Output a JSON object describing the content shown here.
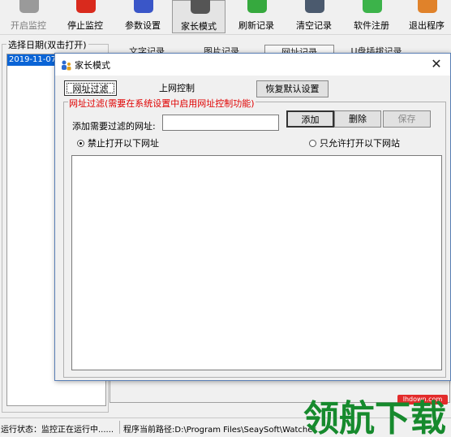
{
  "colors": {
    "selection": "#0a64d6",
    "warning_text": "#e00000",
    "window_bg": "#f0f0f0",
    "watermark_red": "#e32b2b",
    "watermark_green": "#168a2d"
  },
  "toolbar": {
    "items": [
      {
        "label": "开启监控",
        "icon": "start-icon",
        "state": "disabled"
      },
      {
        "label": "停止监控",
        "icon": "stop-icon",
        "state": "normal"
      },
      {
        "label": "参数设置",
        "icon": "settings-icon",
        "state": "normal"
      },
      {
        "label": "家长模式",
        "icon": "parent-mode-icon",
        "state": "pressed"
      },
      {
        "label": "刷新记录",
        "icon": "refresh-icon",
        "state": "normal"
      },
      {
        "label": "清空记录",
        "icon": "clear-icon",
        "state": "normal"
      },
      {
        "label": "软件注册",
        "icon": "register-icon",
        "state": "normal"
      },
      {
        "label": "退出程序",
        "icon": "exit-icon",
        "state": "normal"
      }
    ]
  },
  "date_panel": {
    "title": "选择日期(双击打开)",
    "selected_date": "2019-11-07"
  },
  "record_tabs": [
    "文字记录",
    "图片记录",
    "网址记录",
    "U盘插拔记录"
  ],
  "status_bar": {
    "status": "运行状态：监控正在运行中......",
    "path": "程序当前路径:D:\\Program Files\\SeaySoft\\Watcher"
  },
  "dialog": {
    "title": "家长模式",
    "close_glyph": "✕",
    "tabs": [
      "网址过滤",
      "上网控制"
    ],
    "restore_button": "恢复默认设置",
    "filter_group_title": "网址过滤(需要在系统设置中启用网址控制功能)",
    "url_label": "添加需要过滤的网址:",
    "url_value": "",
    "buttons": {
      "add": "添加",
      "delete": "删除",
      "save": "保存"
    },
    "radio_block": "禁止打开以下网址",
    "radio_allow": "只允许打开以下网站",
    "radio_selected": "block"
  },
  "watermark": {
    "url": "lhdown.com",
    "text": "领航下载"
  }
}
